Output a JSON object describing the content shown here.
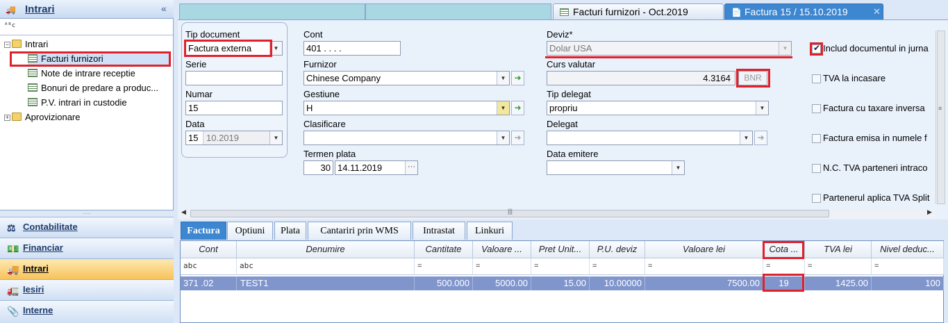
{
  "left_panel": {
    "title": "Intrari",
    "filter_icon": "abc-filter-icon",
    "tree": {
      "root": "Intrari",
      "children": [
        "Facturi furnizori",
        "Note de intrare receptie",
        "Bonuri de predare a produc...",
        "P.V. intrari in custodie"
      ],
      "second_root": "Aprovizionare"
    },
    "nav": [
      "Contabilitate",
      "Financiar",
      "Intrari",
      "Iesiri",
      "Interne"
    ]
  },
  "tabs": {
    "tab1": "Facturi furnizori - Oct.2019",
    "tab2": "Factura 15 / 15.10.2019"
  },
  "form": {
    "tip_document_label": "Tip document",
    "tip_document_value": "Factura externa",
    "serie_label": "Serie",
    "serie_value": "",
    "numar_label": "Numar",
    "numar_value": "15",
    "data_label": "Data",
    "data_day": "15",
    "data_month": "10.2019",
    "cont_label": "Cont",
    "cont_value": "401 . . . .",
    "furnizor_label": "Furnizor",
    "furnizor_value": "Chinese Company",
    "gestiune_label": "Gestiune",
    "gestiune_value": "H",
    "clasificare_label": "Clasificare",
    "clasificare_value": "",
    "termen_label": "Termen plata",
    "termen_days": "30",
    "termen_date": "14.11.2019",
    "deviz_label": "Deviz*",
    "deviz_value": "Dolar USA",
    "curs_label": "Curs valutar",
    "curs_value": "4.3164",
    "curs_source": "BNR",
    "tip_delegat_label": "Tip delegat",
    "tip_delegat_value": "propriu",
    "delegat_label": "Delegat",
    "delegat_value": "",
    "data_emitere_label": "Data emitere",
    "data_emitere_value": ""
  },
  "checkboxes": [
    {
      "label": "Includ documentul in jurna",
      "checked": true
    },
    {
      "label": "TVA la incasare",
      "checked": false
    },
    {
      "label": "Factura cu taxare inversa",
      "checked": false
    },
    {
      "label": "Factura emisa in numele f",
      "checked": false
    },
    {
      "label": "N.C. TVA parteneri intraco",
      "checked": false
    },
    {
      "label": "Partenerul aplica TVA Split",
      "checked": false
    }
  ],
  "bottom_tabs": [
    "Factura",
    "Optiuni",
    "Plata",
    "Cantariri prin WMS",
    "Intrastat",
    "Linkuri"
  ],
  "grid": {
    "columns": [
      "Cont",
      "Denumire",
      "Cantitate",
      "Valoare ...",
      "Pret Unit...",
      "P.U. deviz",
      "Valoare lei",
      "Cota ...",
      "TVA lei",
      "Nivel deduc..."
    ],
    "filter_text": "abc",
    "filter_eq": "=",
    "rows": [
      [
        "371 .02",
        "TEST1",
        "500.000",
        "5000.00",
        "15.00",
        "10.00000",
        "7500.00",
        "19",
        "1425.00",
        "100"
      ]
    ]
  },
  "colors": {
    "highlight": "#e0202a",
    "selected_row": "#7f95cc",
    "active_nav": "#f8c25a"
  }
}
